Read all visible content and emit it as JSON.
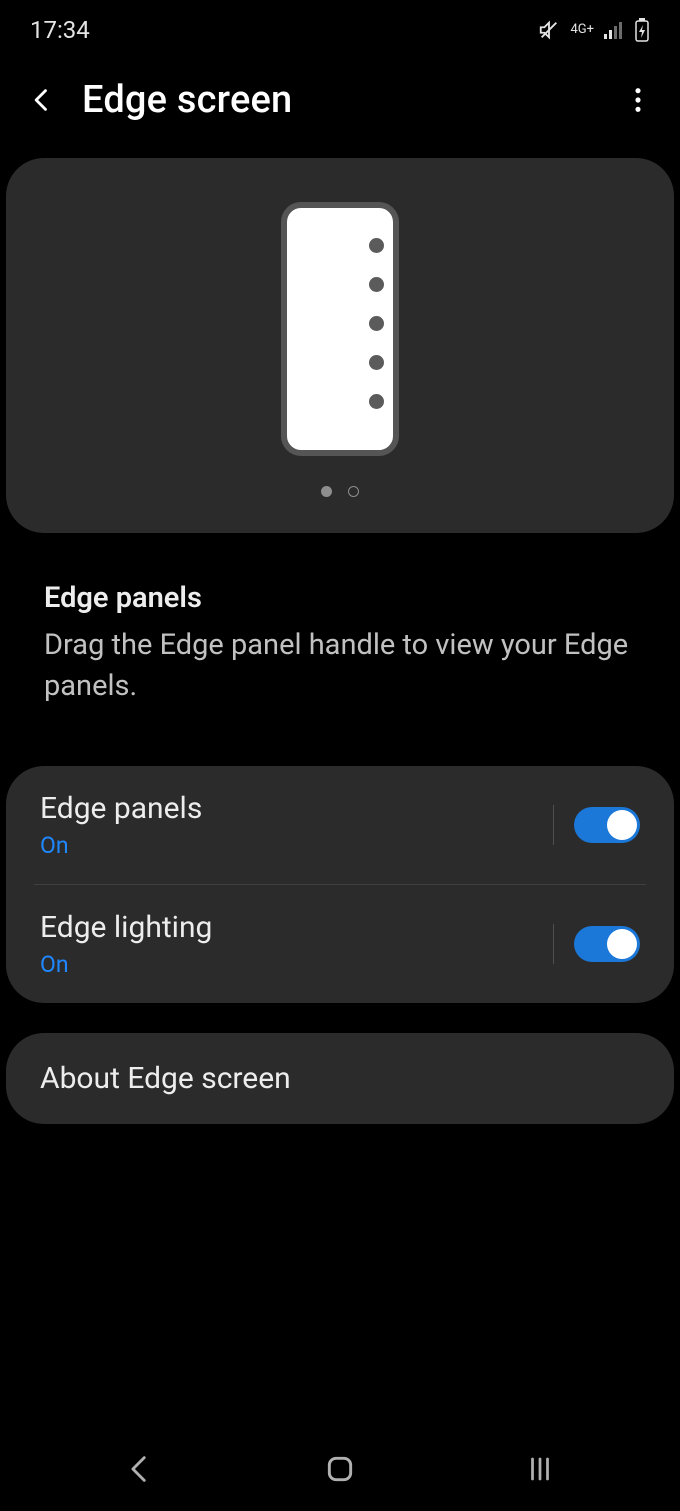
{
  "status": {
    "time": "17:34",
    "network_label": "4G+"
  },
  "header": {
    "title": "Edge screen"
  },
  "section": {
    "title": "Edge panels",
    "subtitle": "Drag the Edge panel handle to view your Edge panels."
  },
  "rows": {
    "edge_panels": {
      "title": "Edge panels",
      "status": "On",
      "on": true
    },
    "edge_lighting": {
      "title": "Edge lighting",
      "status": "On",
      "on": true
    }
  },
  "about": {
    "title": "About Edge screen"
  }
}
